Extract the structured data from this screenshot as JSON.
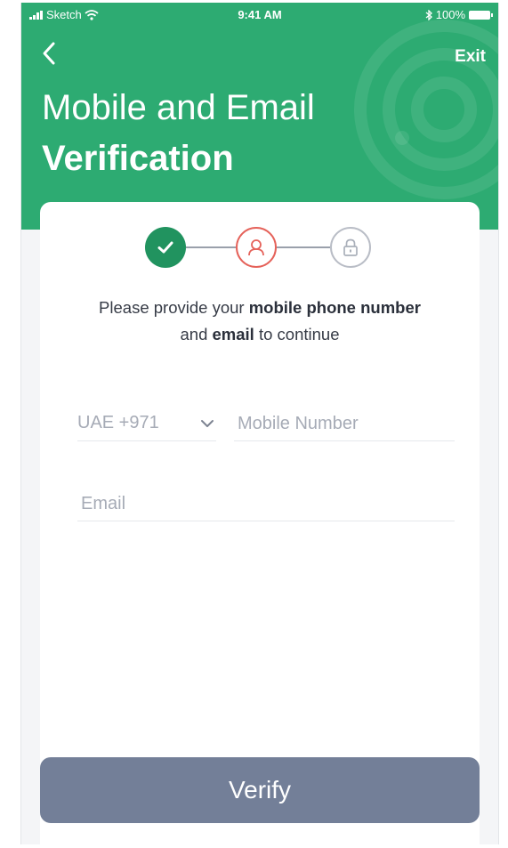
{
  "statusbar": {
    "carrier": "Sketch",
    "time": "9:41 AM",
    "battery": "100%"
  },
  "header": {
    "back_icon": "chevron-left-icon",
    "exit_label": "Exit",
    "title_line1": "Mobile and Email",
    "title_line2": "Verification",
    "background_color": "#2dab72"
  },
  "stepper": {
    "steps": [
      {
        "icon": "checkmark-icon",
        "state": "completed",
        "color": "#21935f"
      },
      {
        "icon": "user-icon",
        "state": "current",
        "color": "#e5625a"
      },
      {
        "icon": "lock-icon",
        "state": "upcoming",
        "color": "#b9bdc6"
      }
    ]
  },
  "instructions": {
    "part1": "Please provide your ",
    "bold1": "mobile phone number",
    "part2": "and ",
    "bold2": "email",
    "part3": " to continue"
  },
  "form": {
    "country_code": "UAE +971",
    "mobile_placeholder": "Mobile Number",
    "email_placeholder": "Email"
  },
  "verify_button": {
    "label": "Verify",
    "color": "#737f98"
  }
}
